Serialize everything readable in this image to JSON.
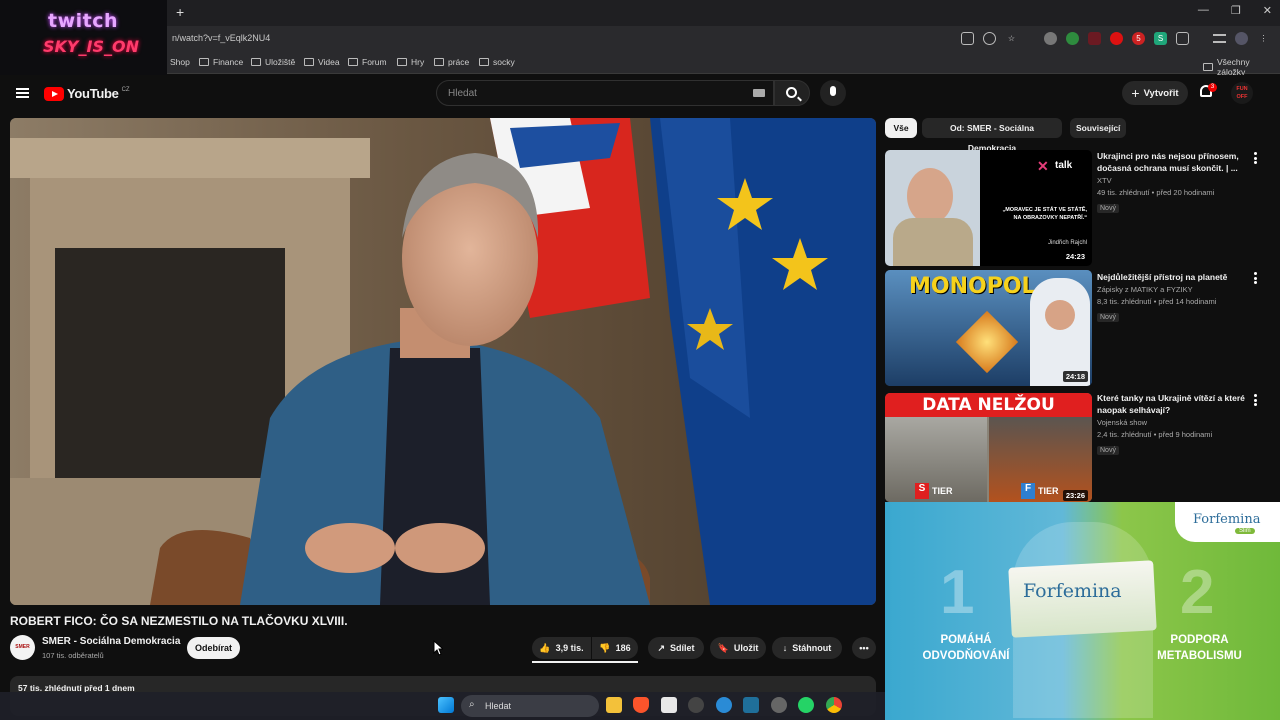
{
  "browser": {
    "new_tab_symbol": "+",
    "url": "n/watch?v=f_vEqlk2NU4",
    "window_controls": [
      "—",
      "❐",
      "✕"
    ],
    "bookmarks": [
      "Shop",
      "Finance",
      "Uložiště",
      "Videa",
      "Forum",
      "Hry",
      "práce",
      "socky"
    ],
    "all_bookmarks": "Všechny záložky"
  },
  "overlay": {
    "line1": "twitch",
    "line2": "SKY_IS_ON"
  },
  "header": {
    "logo_text": "YouTube",
    "region": "CZ",
    "search_placeholder": "Hledat",
    "create_label": "Vytvořit",
    "notifications_count": "3",
    "avatar_text": "FUN OFF"
  },
  "video": {
    "title": "ROBERT FICO: ČO SA NEZMESTILO NA TLAČOVKU XLVIII.",
    "channel_name": "SMER - Sociálna Demokracia",
    "channel_avatar_text": "SMER",
    "subscribers": "107 tis. odběratelů",
    "subscribe_label": "Odebírat",
    "likes": "3,9 tis.",
    "dislikes": "186",
    "share_label": "Sdílet",
    "save_label": "Uložit",
    "download_label": "Stáhnout",
    "stats": "57 tis. zhlédnutí  před 1 dnem"
  },
  "chips": [
    "Vše",
    "Od: SMER - Sociálna Demokracia",
    "Související"
  ],
  "related": [
    {
      "title": "Ukrajinci pro nás nejsou přínosem, dočasná ochrana musí skončit. | ...",
      "channel": "XTV",
      "meta": "49 tis. zhlédnutí • před 20 hodinami",
      "badge": "Nový",
      "duration": "24:23",
      "thumb_brand": "talk",
      "thumb_quote": "„MORAVEC JE STÁT VE STÁTĚ, NA OBRAZOVKY NEPATŘÍ.“",
      "thumb_name": "Jindřich Rajchl"
    },
    {
      "title": "Nejdůležitější přístroj na planetě",
      "channel": "Zápisky z MATIKY a FYZIKY",
      "meta": "8,3 tis. zhlédnutí • před 14 hodinami",
      "badge": "Nový",
      "duration": "24:18",
      "thumb_text": "MONOPOL"
    },
    {
      "title": "Které tanky na Ukrajině vítězí a které naopak selhávají?",
      "channel": "Vojenská show",
      "meta": "2,4 tis. zhlédnutí • před 9 hodinami",
      "badge": "Nový",
      "duration": "23:26",
      "thumb_text": "DATA NELŽOU",
      "tier_left_letter": "S",
      "tier_right_letter": "F",
      "tier_word": "TIER"
    }
  ],
  "ad": {
    "brand": "Forfemina",
    "brand_sub": "Slim",
    "left_number": "1",
    "left_text": "POMÁHÁ ODVODŇOVÁNÍ",
    "right_number": "2",
    "right_text": "PODPORA METABOLISMU",
    "box_text": "Forfemina"
  },
  "taskbar": {
    "search_label": "Hledat"
  }
}
